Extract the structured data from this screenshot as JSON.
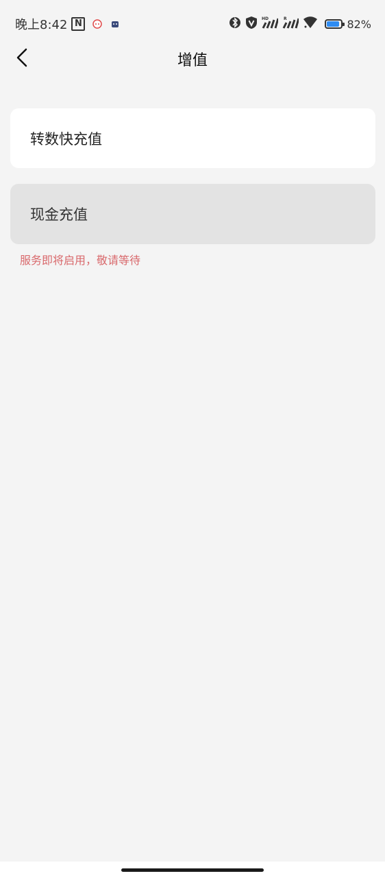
{
  "status_bar": {
    "time": "晚上8:42",
    "nfc_glyph": "N",
    "icons": [
      "nfc-icon",
      "app-notification-icon",
      "app-notification-icon-2",
      "bluetooth-icon",
      "vpn-shield-icon",
      "hd-signal-icon",
      "signal-icon",
      "wifi-icon",
      "battery-icon"
    ],
    "battery_level": 0.82,
    "battery_text": "82%",
    "battery_color": "#2f8cf2"
  },
  "header": {
    "title": "增值",
    "back_icon": "chevron-left-icon"
  },
  "options": {
    "transfer_topup": "转数快充值",
    "cash_topup": "现金充值"
  },
  "notice": {
    "text": "服务即将启用，敬请等待",
    "color": "#d9696c"
  }
}
